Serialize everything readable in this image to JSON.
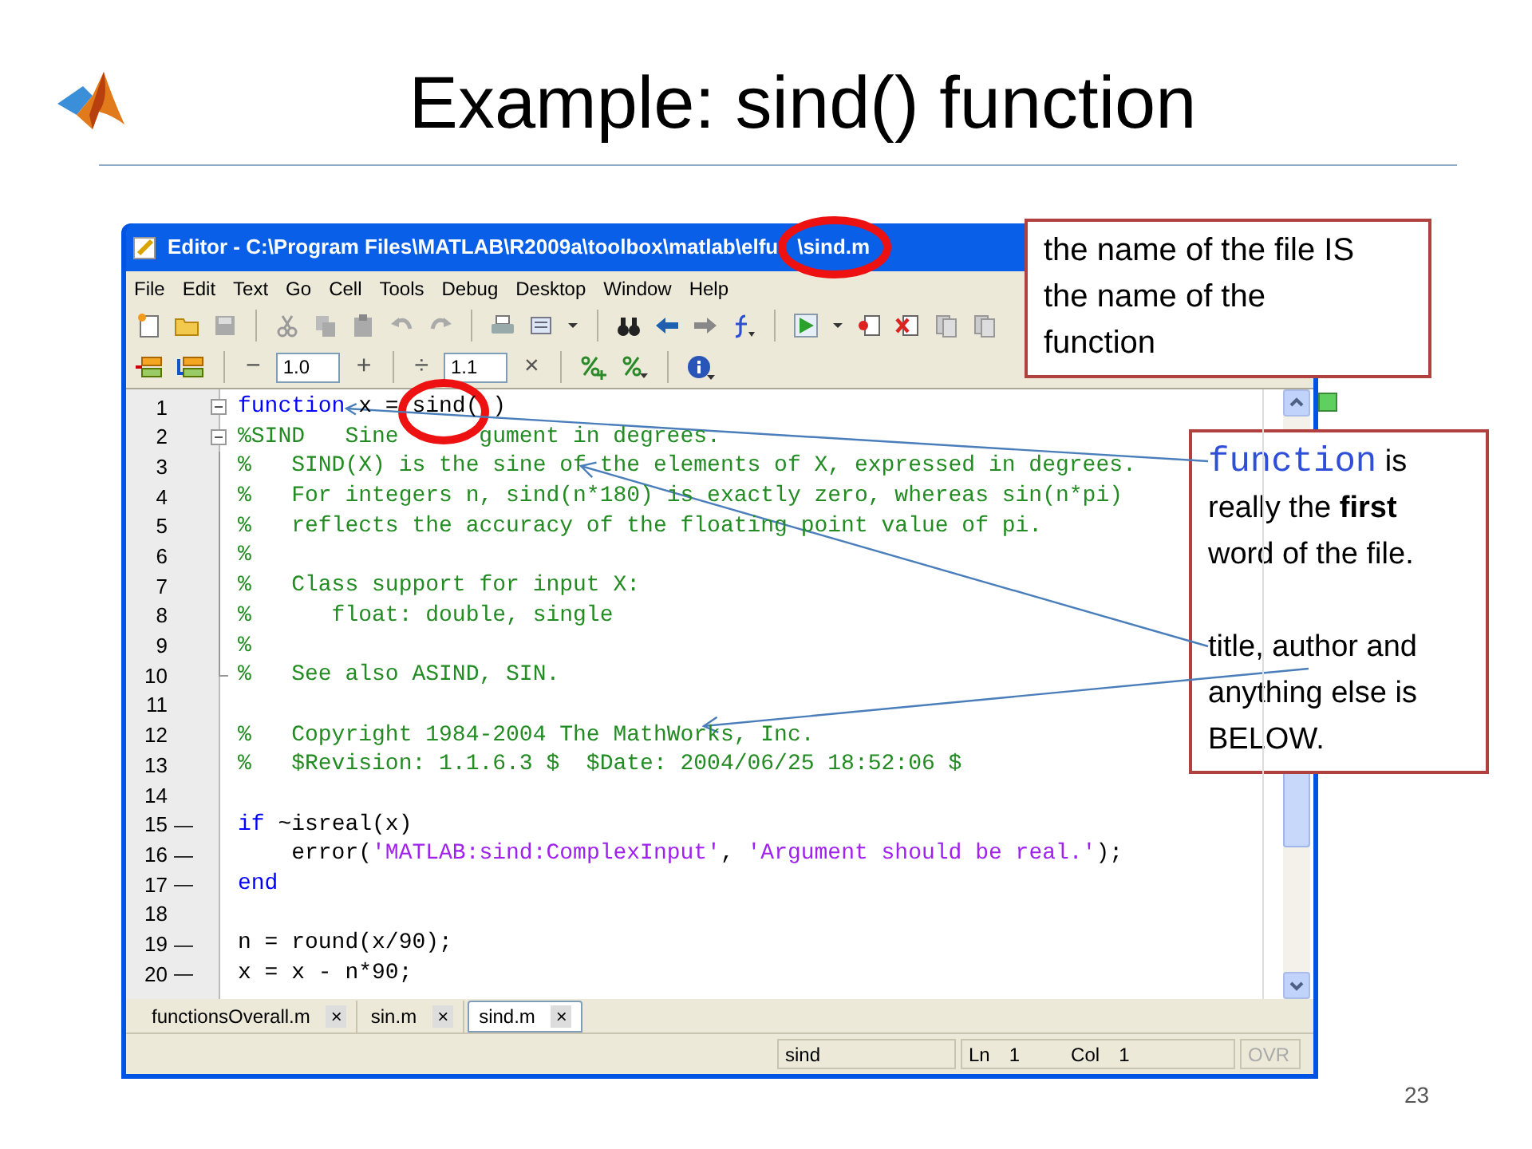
{
  "slide": {
    "title": "Example: sind() function",
    "page_number": "23"
  },
  "editor": {
    "window_title": "Editor - C:\\Program Files\\MATLAB\\R2009a\\toolbox\\matlab\\elfu",
    "window_title_end": "\\sind.m",
    "menu": [
      "File",
      "Edit",
      "Text",
      "Go",
      "Cell",
      "Tools",
      "Debug",
      "Desktop",
      "Window",
      "Help"
    ],
    "toolbar_groups": [
      [
        {
          "kind": "new-file"
        },
        {
          "kind": "folder"
        },
        {
          "kind": "save"
        }
      ],
      [
        {
          "kind": "cut"
        },
        {
          "kind": "copy"
        },
        {
          "kind": "paste"
        },
        {
          "kind": "undo"
        },
        {
          "kind": "redo"
        }
      ],
      [
        {
          "kind": "print"
        },
        {
          "kind": "page"
        },
        {
          "kind": "caret"
        }
      ],
      [
        {
          "kind": "binoculars"
        },
        {
          "kind": "back"
        },
        {
          "kind": "forward"
        },
        {
          "kind": "function"
        }
      ],
      [
        {
          "kind": "run"
        },
        {
          "kind": "caret"
        },
        {
          "kind": "breakpoint-set"
        },
        {
          "kind": "breakpoint-clear"
        },
        {
          "kind": "stack"
        },
        {
          "kind": "stack"
        }
      ]
    ],
    "cell_toolbar": {
      "minus": "−",
      "step": "1.0",
      "plus": "+",
      "divide": "÷",
      "factor": "1.1",
      "times": "×"
    },
    "lines": [
      {
        "number": "1",
        "kind": "fold-open",
        "tokens": [
          {
            "kind": "keyword",
            "text": "function"
          },
          {
            "kind": "plain",
            "text": " x = sind("
          },
          {
            "kind": "covered"
          },
          {
            "kind": "plain",
            "text": ")"
          }
        ]
      },
      {
        "number": "2",
        "kind": "fold-open",
        "tokens": [
          {
            "kind": "comment",
            "text": "%SIND   Sine "
          },
          {
            "kind": "covered"
          },
          {
            "kind": "covered"
          },
          {
            "kind": "covered"
          },
          {
            "kind": "covered"
          },
          {
            "kind": "covered"
          },
          {
            "kind": "comment",
            "text": "gument in degrees."
          }
        ]
      },
      {
        "number": "3",
        "kind": "fold-line",
        "tokens": [
          {
            "kind": "comment",
            "text": "%   SIND(X) is the sine of the elements of X, expressed in degrees."
          }
        ]
      },
      {
        "number": "4",
        "kind": "fold-line",
        "tokens": [
          {
            "kind": "comment",
            "text": "%   For integers n, sind(n*180) is exactly zero, whereas sin(n*pi)"
          }
        ]
      },
      {
        "number": "5",
        "kind": "fold-line",
        "tokens": [
          {
            "kind": "comment",
            "text": "%   reflects the accuracy of the floating point value of pi."
          }
        ]
      },
      {
        "number": "6",
        "kind": "fold-line",
        "tokens": [
          {
            "kind": "comment",
            "text": "%"
          }
        ]
      },
      {
        "number": "7",
        "kind": "fold-line",
        "tokens": [
          {
            "kind": "comment",
            "text": "%   Class support for input X:"
          }
        ]
      },
      {
        "number": "8",
        "kind": "fold-line",
        "tokens": [
          {
            "kind": "comment",
            "text": "%      float: double, single"
          }
        ]
      },
      {
        "number": "9",
        "kind": "fold-line",
        "tokens": [
          {
            "kind": "comment",
            "text": "%"
          }
        ]
      },
      {
        "number": "10",
        "kind": "fold-end",
        "tokens": [
          {
            "kind": "comment",
            "text": "%   See also ASIND, SIN."
          }
        ]
      },
      {
        "number": "11",
        "kind": "plain"
      },
      {
        "number": "12",
        "kind": "plain",
        "tokens": [
          {
            "kind": "comment",
            "text": "%   Copyright 1984-2004 The MathWorks, Inc."
          }
        ]
      },
      {
        "number": "13",
        "kind": "plain",
        "tokens": [
          {
            "kind": "comment",
            "text": "%   $Revision: 1.1.6.3 $  $Date: 2004/06/25 18:52:06 $"
          }
        ]
      },
      {
        "number": "14",
        "kind": "plain"
      },
      {
        "number": "15",
        "kind": "plain",
        "marker": "—",
        "tokens": [
          {
            "kind": "keyword",
            "text": "if"
          },
          {
            "kind": "plain",
            "text": " ~isreal(x)"
          }
        ]
      },
      {
        "number": "16",
        "kind": "plain",
        "marker": "—",
        "tokens": [
          {
            "kind": "plain",
            "text": "    error("
          },
          {
            "kind": "string",
            "text": "'MATLAB:sind:ComplexInput'"
          },
          {
            "kind": "plain",
            "text": ", "
          },
          {
            "kind": "string",
            "text": "'Argument should be real.'"
          },
          {
            "kind": "plain",
            "text": ");"
          }
        ]
      },
      {
        "number": "17",
        "kind": "plain",
        "marker": "—",
        "tokens": [
          {
            "kind": "keyword",
            "text": "end"
          }
        ]
      },
      {
        "number": "18",
        "kind": "plain"
      },
      {
        "number": "19",
        "kind": "plain",
        "marker": "—",
        "tokens": [
          {
            "kind": "plain",
            "text": "n = round(x/90);"
          }
        ]
      },
      {
        "number": "20",
        "kind": "plain",
        "marker": "—",
        "tokens": [
          {
            "kind": "plain",
            "text": "x = x - n*90;"
          }
        ]
      }
    ],
    "tabs": [
      {
        "label": "functionsOverall.m",
        "close": "×",
        "selected": false
      },
      {
        "label": "sin.m",
        "close": "×",
        "selected": false
      },
      {
        "label": "sind.m",
        "close": "×",
        "selected": true
      }
    ],
    "status_bar": {
      "function": "sind",
      "ln_label": "Ln",
      "ln": "1",
      "col_label": "Col",
      "col": "1",
      "ovr": "OVR"
    }
  },
  "callouts": [
    {
      "kind": "plain",
      "text": "the name of the file IS the name of the function"
    },
    {
      "kind": "detail",
      "code_word": "function",
      "text": " is really the **first** word of the file.",
      "note": "title, author and anything else is BELOW."
    }
  ]
}
